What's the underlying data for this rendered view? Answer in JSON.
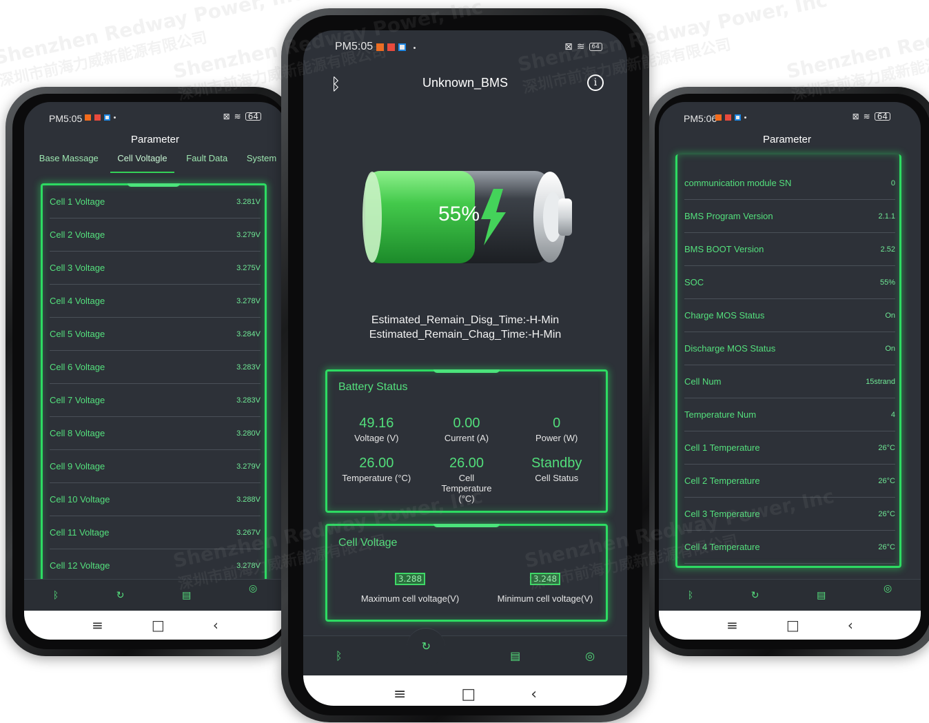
{
  "watermark": {
    "line1": "Shenzhen Redway Power, Inc",
    "line2": "深圳市前海力威新能源有限公司"
  },
  "left_phone": {
    "time": "PM5:05",
    "title": "Parameter",
    "tabs": [
      "Base Massage",
      "Cell Voltagle",
      "Fault Data",
      "System"
    ],
    "active_tab": 1,
    "rows": [
      {
        "label": "Cell 1 Voltage",
        "value": "3.281V"
      },
      {
        "label": "Cell 2 Voltage",
        "value": "3.279V"
      },
      {
        "label": "Cell 3 Voltage",
        "value": "3.275V"
      },
      {
        "label": "Cell 4 Voltage",
        "value": "3.278V"
      },
      {
        "label": "Cell 5 Voltage",
        "value": "3.284V"
      },
      {
        "label": "Cell 6 Voltage",
        "value": "3.283V"
      },
      {
        "label": "Cell 7 Voltage",
        "value": "3.283V"
      },
      {
        "label": "Cell 8 Voltage",
        "value": "3.280V"
      },
      {
        "label": "Cell 9 Voltage",
        "value": "3.279V"
      },
      {
        "label": "Cell 10 Voltage",
        "value": "3.288V"
      },
      {
        "label": "Cell 11 Voltage",
        "value": "3.267V"
      },
      {
        "label": "Cell 12 Voltage",
        "value": "3.278V"
      }
    ]
  },
  "center_phone": {
    "time": "PM5:05",
    "title": "Unknown_BMS",
    "soc": "55%",
    "soc_level": 0.55,
    "remain_disg": "Estimated_Remain_Disg_Time:-H-Min",
    "remain_chag": "Estimated_Remain_Chag_Time:-H-Min",
    "battery_status": {
      "title": "Battery Status",
      "stats": [
        {
          "value": "49.16",
          "label": "Voltage  (V)"
        },
        {
          "value": "0.00",
          "label": "Current  (A)"
        },
        {
          "value": "0",
          "label": "Power  (W)"
        },
        {
          "value": "26.00",
          "label": "Temperature  (°C)"
        },
        {
          "value": "26.00",
          "label": "Cell Temperature (°C)"
        },
        {
          "value": "Standby",
          "label": "Cell Status"
        }
      ]
    },
    "cell_voltage": {
      "title": "Cell Voltage",
      "max_value": "3.288",
      "max_label": "Maximum cell voltage(V)",
      "min_value": "3.248",
      "min_label": "Minimum cell voltage(V)"
    }
  },
  "right_phone": {
    "time": "PM5:06",
    "title": "Parameter",
    "rows": [
      {
        "label": "communication module SN",
        "value": "0"
      },
      {
        "label": "BMS Program Version",
        "value": "2.1.1"
      },
      {
        "label": "BMS BOOT Version",
        "value": "2.52"
      },
      {
        "label": "SOC",
        "value": "55%"
      },
      {
        "label": "Charge MOS Status",
        "value": "On"
      },
      {
        "label": "Discharge MOS Status",
        "value": "On"
      },
      {
        "label": "Cell Num",
        "value": "15strand"
      },
      {
        "label": "Temperature Num",
        "value": "4"
      },
      {
        "label": "Cell 1 Temperature",
        "value": "26°C"
      },
      {
        "label": "Cell 2 Temperature",
        "value": "26°C"
      },
      {
        "label": "Cell 3 Temperature",
        "value": "26°C"
      },
      {
        "label": "Cell 4 Temperature",
        "value": "26°C"
      }
    ]
  },
  "status_icons": [
    "mi-icon",
    "red-square-icon",
    "mail-icon",
    "dot-icon",
    "sim-x-icon",
    "wifi-icon",
    "battery-icon"
  ],
  "battery_indicator": "64",
  "colors": {
    "accent": "#2ddb62",
    "screen_bg": "#2d3138",
    "text_green": "#54e07d"
  }
}
